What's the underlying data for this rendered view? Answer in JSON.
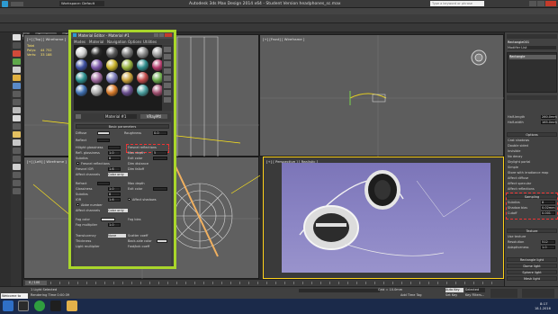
{
  "window": {
    "title": "Autodesk 3ds Max Design 2014 x64 - Student Version    headphones_sc.max",
    "workspace": "Workspace: Default",
    "search_placeholder": "Type a keyword or phrase"
  },
  "menubar": [
    "Edit",
    "Tools",
    "Group",
    "Views",
    "Create",
    "Modifiers",
    "Animation",
    "Graph Editors",
    "Rendering",
    "Lighting Analysis",
    "Civil View",
    "Customize",
    "MAXScript",
    "Help"
  ],
  "ribbon": {
    "tabs": [
      "Modeling",
      "Freeform",
      "Selection",
      "Object Paint",
      "Populate"
    ],
    "row2": "Polygon Modeling"
  },
  "viewports": {
    "top_left": "[+] [Top] [ Wireframe ]",
    "top_right": "[+] [Front] [ Wireframe ]",
    "bottom_left": "[+] [Left] [ Wireframe ]",
    "bottom_right": "[+] [ Perspective ] [ Realistic ]",
    "stats": {
      "total": "Total",
      "polys": "Polys:",
      "polys_val": "44 752",
      "verts": "Verts:",
      "verts_val": "33 188"
    }
  },
  "material_editor": {
    "title": "Material Editor - Material #1",
    "menu": [
      "Modes",
      "Material",
      "Navigation",
      "Options",
      "Utilities"
    ],
    "material_name": "Material #1",
    "material_type": "VRayMtl",
    "basic_params": "Basic parameters",
    "labels": {
      "diffuse": "Diffuse",
      "roughness": "Roughness",
      "reflect": "Reflect",
      "hilight_gloss": "Hilight glossiness",
      "refl_gloss": "Refl. glossiness",
      "subdivs": "Subdivs",
      "fresnel_refl": "Fresnel reflections",
      "fresnel_ior": "Fresnel IOR",
      "affect_channels": "Affect channels",
      "color_only": "Color only",
      "max_depth": "Max depth",
      "exit_color": "Exit color",
      "dim_distance": "Dim distance",
      "dim_falloff": "Dim falloff",
      "refract": "Refract",
      "glossiness": "Glossiness",
      "ior": "IOR",
      "abbe": "Abbe number",
      "affect_shadows": "Affect shadows",
      "fog_color": "Fog color",
      "fog_multiplier": "Fog multiplier",
      "fog_bias": "Fog bias",
      "translucency": "Translucency",
      "none": "None",
      "thickness": "Thickness",
      "back_side": "Back-side color",
      "scatter_coeff": "Scatter coeff",
      "light_multiplier": "Light multiplier",
      "fwd_bck": "Fwd/bck coeff",
      "roughness_val": "0.0",
      "gloss_val": "1.0",
      "subdivs_val": "8",
      "ior_val": "1.6",
      "depth_val": "5",
      "mult_val": "1.0"
    }
  },
  "command_panel": {
    "object_name": "Rectangle001",
    "modifier_list": "Modifier List",
    "modifier_item": "Rectangle",
    "sections": {
      "options": "Options",
      "sampling": "Sampling",
      "texture": "Texture",
      "parameters": "Rectangle light",
      "general": "General"
    },
    "rows": [
      "Half-length",
      "Half-width",
      "Cast shadows",
      "Double sided",
      "Invisible",
      "No decay",
      "Skylight portal",
      "Simple",
      "Store with irradiance map",
      "Affect diffuse",
      "Affect specular",
      "Affect reflections",
      "Subdivs",
      "Shadow bias",
      "Cutoff",
      "Use texture",
      "Resolution",
      "Adaptiveness",
      "Dome light",
      "Sphere light",
      "Mesh light"
    ],
    "values": {
      "half_len": "260.0mm",
      "half_wid": "165.0mm",
      "subdivs": "8",
      "bias": "0.02mm",
      "cutoff": "0.001",
      "res": "512",
      "adapt": "1.0"
    }
  },
  "bottom": {
    "welcome": "Welcome to MAX",
    "status1": "1 Light Selected",
    "status2": "Rendering Time 0:00:39",
    "timeline": "0 / 100",
    "add_time_tag": "Add Time Tag",
    "key_filter": "Selected",
    "set_key": "Set Key",
    "key_filters": "Key Filters...",
    "grid": "Grid = 10.0mm",
    "auto_key": "Auto Key"
  },
  "taskbar": {
    "time": "8:17",
    "date": "18.1.2016"
  },
  "colors": {
    "editor_border": "#a9d62b",
    "active_viewport": "#ffd21a",
    "render_bg": "#8a84c4"
  }
}
